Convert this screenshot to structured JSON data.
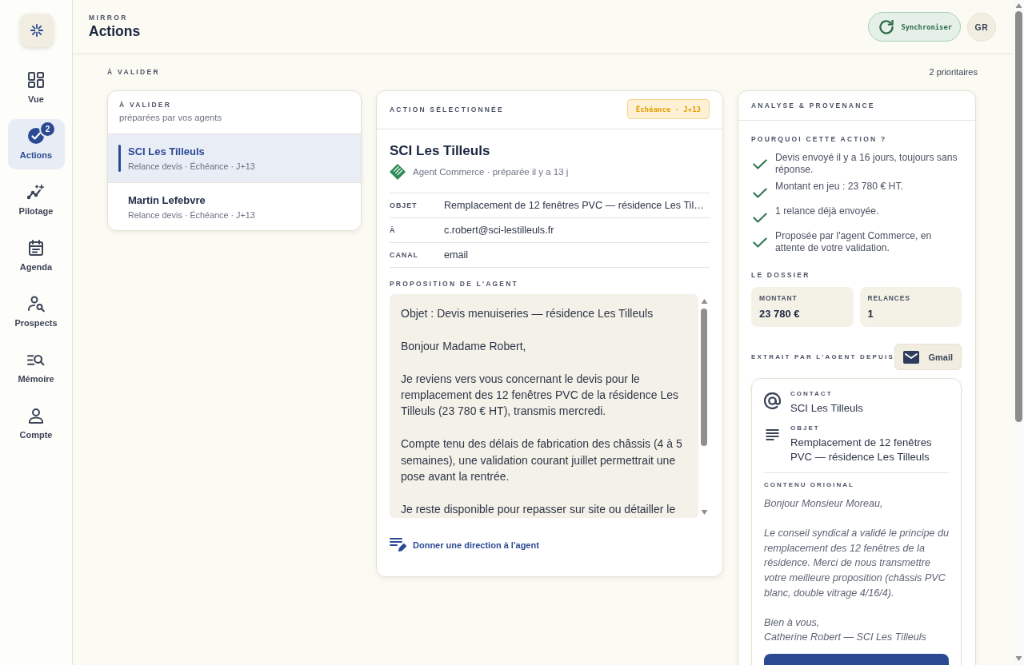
{
  "sidebar": {
    "items": [
      {
        "label": "Vue",
        "selected": false
      },
      {
        "label": "Actions",
        "selected": true,
        "badge": "2"
      },
      {
        "label": "Pilotage",
        "selected": false
      },
      {
        "label": "Agenda",
        "selected": false
      },
      {
        "label": "Prospects",
        "selected": false
      },
      {
        "label": "Mémoire",
        "selected": false
      },
      {
        "label": "Compte",
        "selected": false
      }
    ]
  },
  "header": {
    "eyebrow": "MIRROR",
    "title": "Actions",
    "sync_button": "Synchroniser",
    "avatar": "GR"
  },
  "section": {
    "title": "À VALIDER",
    "count": "2 prioritaires"
  },
  "queue": {
    "title": "À VALIDER",
    "subtitle": "préparées par vos agents",
    "items": [
      {
        "name": "SCI Les Tilleuls",
        "meta": "Relance devis · Échéance · J+13",
        "selected": true
      },
      {
        "name": "Martin Lefebvre",
        "meta": "Relance devis · Échéance · J+13",
        "selected": false
      }
    ]
  },
  "action": {
    "title": "ACTION SÉLECTIONNÉE",
    "deadline_badge": "Échéance · J+13",
    "name": "SCI Les Tilleuls",
    "agent_line": "Agent Commerce · préparée il y a 13 j",
    "fields": [
      {
        "label": "OBJET",
        "value": "Remplacement de 12 fenêtres PVC — résidence Les Til…"
      },
      {
        "label": "À",
        "value": "c.robert@sci-lestilleuls.fr"
      },
      {
        "label": "CANAL",
        "value": "email"
      }
    ],
    "proposal": {
      "title": "PROPOSITION DE L'AGENT",
      "paragraphs": [
        "Objet : Devis menuiseries — résidence Les Tilleuls",
        "Bonjour Madame Robert,",
        "Je reviens vers vous concernant le devis pour le remplacement des 12 fenêtres PVC de la résidence Les Tilleuls (23 780 € HT), transmis mercredi.",
        "Compte tenu des délais de fabrication des châssis (4 à 5 semaines), une validation courant juillet permettrait une pose avant la rentrée.",
        "Je reste disponible pour repasser sur site ou détailler le"
      ]
    },
    "direction_link": "Donner une direction à l'agent"
  },
  "analysis": {
    "title": "ANALYSE & PROVENANCE",
    "why": {
      "title": "POURQUOI CETTE ACTION ?",
      "reasons": [
        "Devis envoyé il y a 16 jours, toujours sans réponse.",
        "Montant en jeu : 23 780 € HT.",
        "1 relance déjà envoyée.",
        "Proposée par l'agent Commerce, en attente de votre validation."
      ]
    },
    "dossier": {
      "title": "LE DOSSIER",
      "stats": [
        {
          "label": "MONTANT",
          "value": "23 780 €"
        },
        {
          "label": "RELANCES",
          "value": "1"
        }
      ]
    },
    "source": {
      "label": "EXTRAIT PAR L'AGENT DEPUIS",
      "chip": "Gmail"
    },
    "email": {
      "fields": [
        {
          "label": "CONTACT",
          "value": "SCI Les Tilleuls"
        },
        {
          "label": "OBJET",
          "value": "Remplacement de 12 fenêtres PVC — résidence Les Tilleuls"
        }
      ],
      "content_title": "CONTENU ORIGINAL",
      "paragraphs": [
        "Bonjour Monsieur Moreau,",
        "Le conseil syndical a validé le principe du remplacement des 12 fenêtres de la résidence. Merci de nous transmettre votre meilleure proposition (châssis PVC blanc, double vitrage 4/16/4).",
        "Bien à vous,\nCatherine Robert — SCI Les Tilleuls"
      ]
    }
  }
}
